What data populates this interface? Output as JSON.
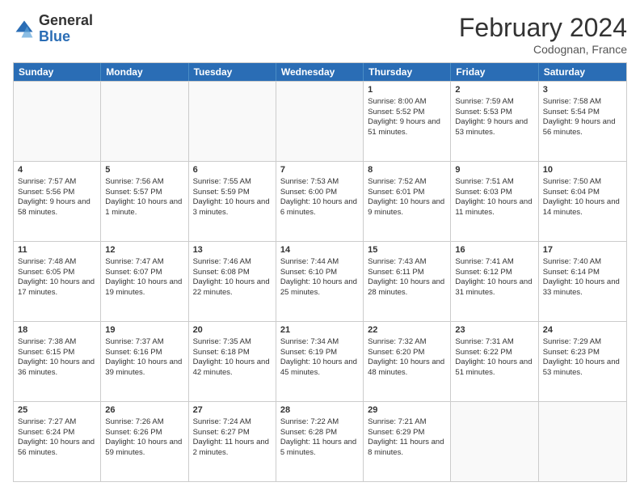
{
  "header": {
    "logo_general": "General",
    "logo_blue": "Blue",
    "month_year": "February 2024",
    "location": "Codognan, France"
  },
  "days_of_week": [
    "Sunday",
    "Monday",
    "Tuesday",
    "Wednesday",
    "Thursday",
    "Friday",
    "Saturday"
  ],
  "rows": [
    [
      {
        "day": "",
        "data": "",
        "empty": true
      },
      {
        "day": "",
        "data": "",
        "empty": true
      },
      {
        "day": "",
        "data": "",
        "empty": true
      },
      {
        "day": "",
        "data": "",
        "empty": true
      },
      {
        "day": "1",
        "data": "Sunrise: 8:00 AM\nSunset: 5:52 PM\nDaylight: 9 hours and 51 minutes.",
        "empty": false
      },
      {
        "day": "2",
        "data": "Sunrise: 7:59 AM\nSunset: 5:53 PM\nDaylight: 9 hours and 53 minutes.",
        "empty": false
      },
      {
        "day": "3",
        "data": "Sunrise: 7:58 AM\nSunset: 5:54 PM\nDaylight: 9 hours and 56 minutes.",
        "empty": false
      }
    ],
    [
      {
        "day": "4",
        "data": "Sunrise: 7:57 AM\nSunset: 5:56 PM\nDaylight: 9 hours and 58 minutes.",
        "empty": false
      },
      {
        "day": "5",
        "data": "Sunrise: 7:56 AM\nSunset: 5:57 PM\nDaylight: 10 hours and 1 minute.",
        "empty": false
      },
      {
        "day": "6",
        "data": "Sunrise: 7:55 AM\nSunset: 5:59 PM\nDaylight: 10 hours and 3 minutes.",
        "empty": false
      },
      {
        "day": "7",
        "data": "Sunrise: 7:53 AM\nSunset: 6:00 PM\nDaylight: 10 hours and 6 minutes.",
        "empty": false
      },
      {
        "day": "8",
        "data": "Sunrise: 7:52 AM\nSunset: 6:01 PM\nDaylight: 10 hours and 9 minutes.",
        "empty": false
      },
      {
        "day": "9",
        "data": "Sunrise: 7:51 AM\nSunset: 6:03 PM\nDaylight: 10 hours and 11 minutes.",
        "empty": false
      },
      {
        "day": "10",
        "data": "Sunrise: 7:50 AM\nSunset: 6:04 PM\nDaylight: 10 hours and 14 minutes.",
        "empty": false
      }
    ],
    [
      {
        "day": "11",
        "data": "Sunrise: 7:48 AM\nSunset: 6:05 PM\nDaylight: 10 hours and 17 minutes.",
        "empty": false
      },
      {
        "day": "12",
        "data": "Sunrise: 7:47 AM\nSunset: 6:07 PM\nDaylight: 10 hours and 19 minutes.",
        "empty": false
      },
      {
        "day": "13",
        "data": "Sunrise: 7:46 AM\nSunset: 6:08 PM\nDaylight: 10 hours and 22 minutes.",
        "empty": false
      },
      {
        "day": "14",
        "data": "Sunrise: 7:44 AM\nSunset: 6:10 PM\nDaylight: 10 hours and 25 minutes.",
        "empty": false
      },
      {
        "day": "15",
        "data": "Sunrise: 7:43 AM\nSunset: 6:11 PM\nDaylight: 10 hours and 28 minutes.",
        "empty": false
      },
      {
        "day": "16",
        "data": "Sunrise: 7:41 AM\nSunset: 6:12 PM\nDaylight: 10 hours and 31 minutes.",
        "empty": false
      },
      {
        "day": "17",
        "data": "Sunrise: 7:40 AM\nSunset: 6:14 PM\nDaylight: 10 hours and 33 minutes.",
        "empty": false
      }
    ],
    [
      {
        "day": "18",
        "data": "Sunrise: 7:38 AM\nSunset: 6:15 PM\nDaylight: 10 hours and 36 minutes.",
        "empty": false
      },
      {
        "day": "19",
        "data": "Sunrise: 7:37 AM\nSunset: 6:16 PM\nDaylight: 10 hours and 39 minutes.",
        "empty": false
      },
      {
        "day": "20",
        "data": "Sunrise: 7:35 AM\nSunset: 6:18 PM\nDaylight: 10 hours and 42 minutes.",
        "empty": false
      },
      {
        "day": "21",
        "data": "Sunrise: 7:34 AM\nSunset: 6:19 PM\nDaylight: 10 hours and 45 minutes.",
        "empty": false
      },
      {
        "day": "22",
        "data": "Sunrise: 7:32 AM\nSunset: 6:20 PM\nDaylight: 10 hours and 48 minutes.",
        "empty": false
      },
      {
        "day": "23",
        "data": "Sunrise: 7:31 AM\nSunset: 6:22 PM\nDaylight: 10 hours and 51 minutes.",
        "empty": false
      },
      {
        "day": "24",
        "data": "Sunrise: 7:29 AM\nSunset: 6:23 PM\nDaylight: 10 hours and 53 minutes.",
        "empty": false
      }
    ],
    [
      {
        "day": "25",
        "data": "Sunrise: 7:27 AM\nSunset: 6:24 PM\nDaylight: 10 hours and 56 minutes.",
        "empty": false
      },
      {
        "day": "26",
        "data": "Sunrise: 7:26 AM\nSunset: 6:26 PM\nDaylight: 10 hours and 59 minutes.",
        "empty": false
      },
      {
        "day": "27",
        "data": "Sunrise: 7:24 AM\nSunset: 6:27 PM\nDaylight: 11 hours and 2 minutes.",
        "empty": false
      },
      {
        "day": "28",
        "data": "Sunrise: 7:22 AM\nSunset: 6:28 PM\nDaylight: 11 hours and 5 minutes.",
        "empty": false
      },
      {
        "day": "29",
        "data": "Sunrise: 7:21 AM\nSunset: 6:29 PM\nDaylight: 11 hours and 8 minutes.",
        "empty": false
      },
      {
        "day": "",
        "data": "",
        "empty": true
      },
      {
        "day": "",
        "data": "",
        "empty": true
      }
    ]
  ]
}
